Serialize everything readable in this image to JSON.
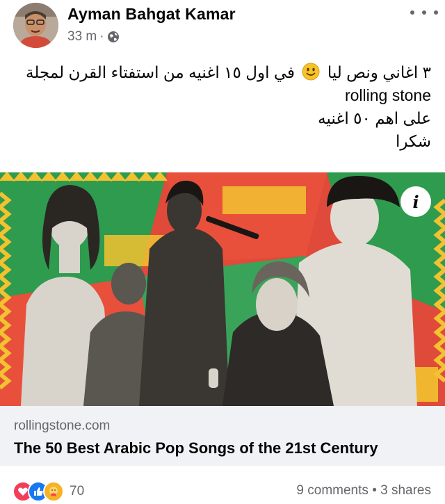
{
  "post": {
    "author": "Ayman Bahgat Kamar",
    "time": "33 m",
    "separator": "·",
    "privacy_icon": "globe-icon",
    "text_line1_part1": "٣ اغاني ونص ليا",
    "text_line1_emoji": "slightly-smiling-face-emoji",
    "text_line1_part2": "في اول ١٥ اغنيه من استفتاء القرن لمجلة",
    "text_line2": "rolling stone",
    "text_line3": "على اهم ٥٠ اغنيه",
    "text_line4": "شكرا"
  },
  "link": {
    "domain": "rollingstone.com",
    "title": "The 50 Best Arabic Pop Songs of the 21st Century",
    "info_icon": "i"
  },
  "footer": {
    "reaction_icons": [
      "love-icon",
      "like-icon",
      "care-icon"
    ],
    "reaction_count": "70",
    "comments": "9 comments",
    "separator": "•",
    "shares": "3 shares"
  },
  "colors": {
    "accent_blue": "#1877f2",
    "love_red": "#f33e58",
    "care_yellow": "#f7b125",
    "secondary_text": "#65676b",
    "link_bg": "#f0f2f5"
  }
}
